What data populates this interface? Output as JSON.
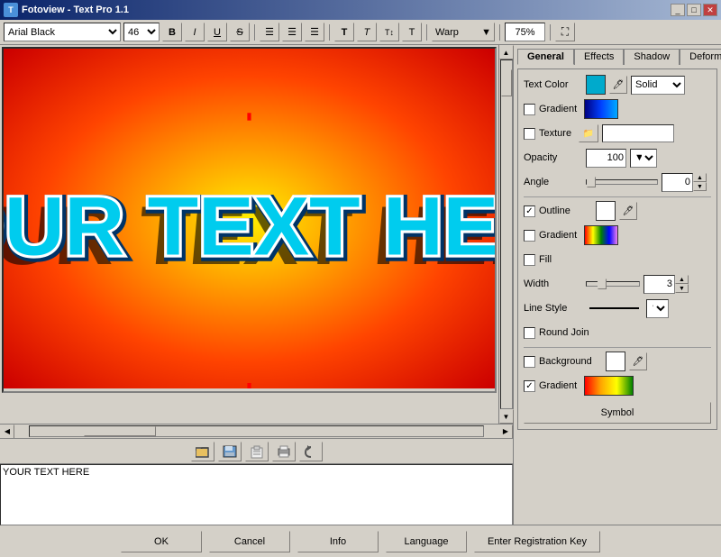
{
  "titlebar": {
    "title": "Fotoview - Text Pro 1.1",
    "icon": "T",
    "controls": [
      "_",
      "□",
      "✕"
    ]
  },
  "toolbar": {
    "font": "Arial Black",
    "size": "46",
    "bold": "B",
    "italic": "I",
    "underline": "U",
    "strikethrough": "S",
    "align_left": "≡",
    "align_center": "≡",
    "align_right": "≡",
    "t1": "T",
    "t2": "T",
    "t3": "T",
    "t4": "T",
    "warp_label": "Warp",
    "zoom": "75%"
  },
  "canvas": {
    "text": "YOUR TEXT HERE"
  },
  "bottom_toolbar": {
    "btn1": "📂",
    "btn2": "💾",
    "btn3": "📋",
    "btn4": "🖨",
    "btn5": "↺"
  },
  "text_area": {
    "value": "YOUR TEXT HERE"
  },
  "tabs": {
    "general": "General",
    "effects": "Effects",
    "shadow": "Shadow",
    "deform": "Deform",
    "active": "general"
  },
  "general": {
    "text_color_label": "Text Color",
    "gradient_label": "Gradient",
    "texture_label": "Texture",
    "opacity_label": "Opacity",
    "angle_label": "Angle",
    "outline_label": "Outline",
    "gradient2_label": "Gradient",
    "fill_label": "Fill",
    "width_label": "Width",
    "line_style_label": "Line Style",
    "round_join_label": "Round Join",
    "background_label": "Background",
    "gradient3_label": "Gradient",
    "symbol_label": "Symbol",
    "solid_option": "Solid",
    "opacity_value": "100",
    "angle_value": "0",
    "width_value": "3",
    "outline_checked": true,
    "gradient_checked": false,
    "texture_checked": false,
    "fill_checked": false,
    "round_join_checked": false,
    "background_checked": false,
    "gradient3_checked": true
  },
  "footer": {
    "ok": "OK",
    "cancel": "Cancel",
    "info": "Info",
    "language": "Language",
    "register": "Enter Registration Key"
  }
}
